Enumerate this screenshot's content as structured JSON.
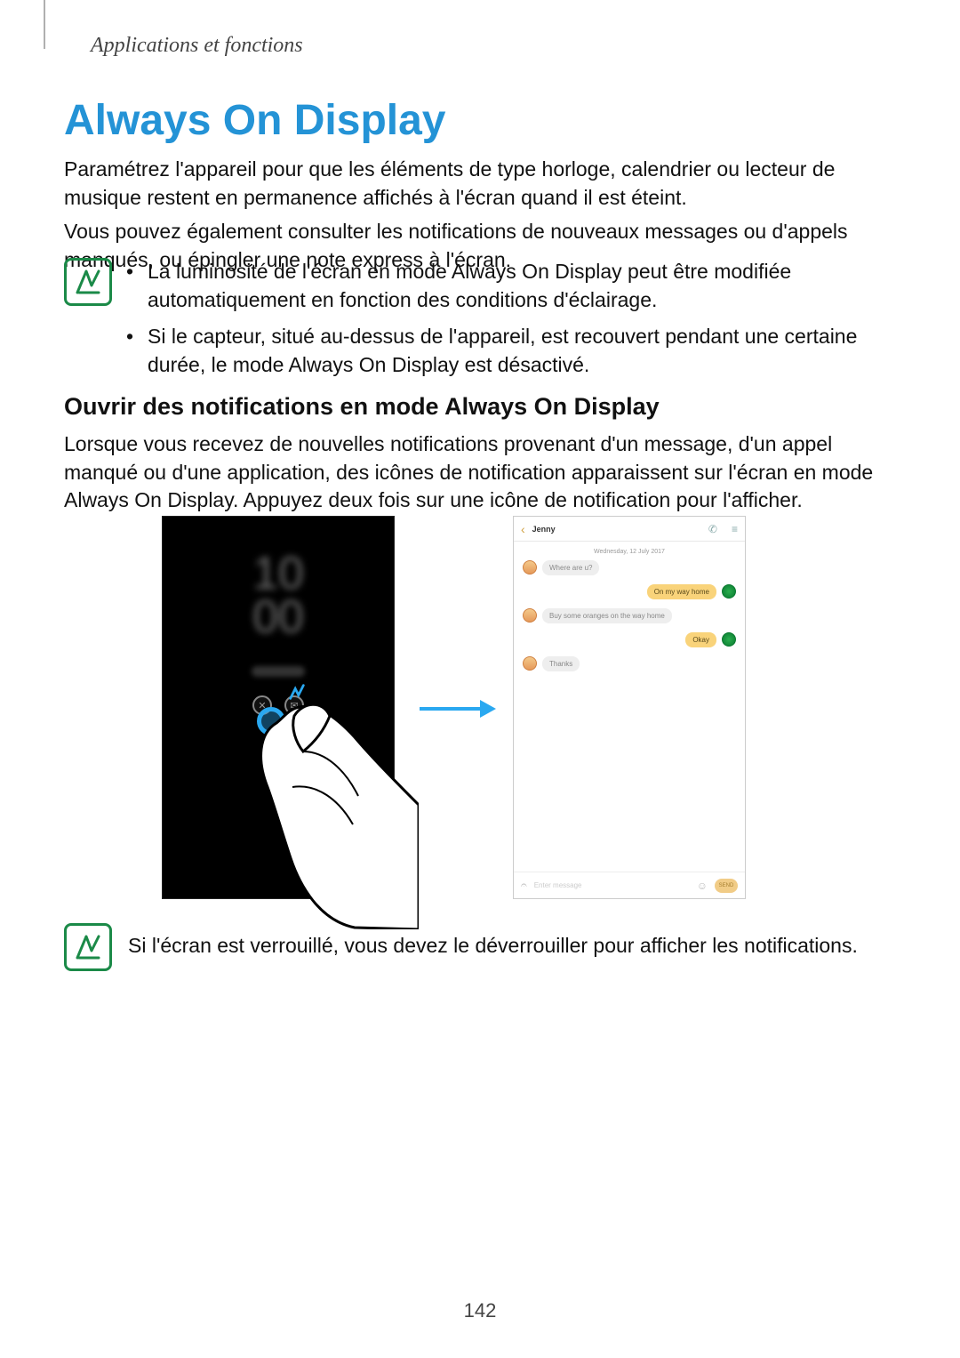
{
  "breadcrumb": "Applications et fonctions",
  "title": "Always On Display",
  "para1": "Paramétrez l'appareil pour que les éléments de type horloge, calendrier ou lecteur de musique restent en permanence affichés à l'écran quand il est éteint.",
  "para2": "Vous pouvez également consulter les notifications de nouveaux messages ou d'appels manqués, ou épingler une note express à l'écran.",
  "bullets": {
    "b1": "La luminosité de l'écran en mode Always On Display peut être modifiée automatiquement en fonction des conditions d'éclairage.",
    "b2": "Si le capteur, situé au-dessus de l'appareil, est recouvert pendant une certaine durée, le mode Always On Display est désactivé."
  },
  "subhead": "Ouvrir des notifications en mode Always On Display",
  "para3": "Lorsque vous recevez de nouvelles notifications provenant d'un message, d'un appel manqué ou d'une application, des icônes de notification apparaissent sur l'écran en mode Always On Display. Appuyez deux fois sur une icône de notification pour l'afficher.",
  "note2": "Si l'écran est verrouillé, vous devez le déverrouiller pour afficher les notifications.",
  "page_number": "142",
  "figure": {
    "aod": {
      "time_display": "10\n00"
    },
    "chat": {
      "contact": "Jenny",
      "date": "Wednesday, 12 July 2017",
      "m1": "Where are u?",
      "m2": "On my way home",
      "m3": "Buy some oranges on the way home",
      "m4": "Okay",
      "m5": "Thanks",
      "input_placeholder": "Enter message",
      "send": "SEND"
    }
  }
}
